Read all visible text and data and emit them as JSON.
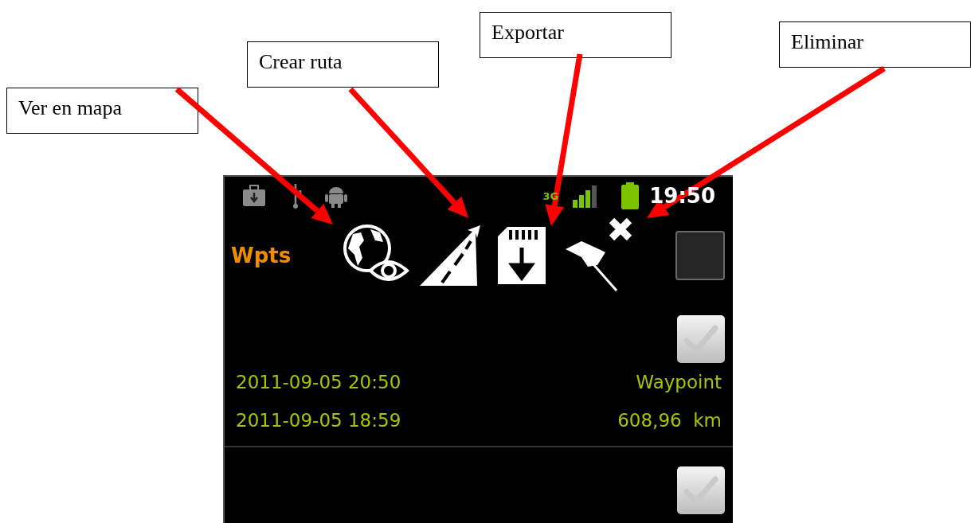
{
  "callouts": [
    {
      "label": "Ver en mapa"
    },
    {
      "label": "Crear ruta"
    },
    {
      "label": "Exportar"
    },
    {
      "label": "Eliminar"
    }
  ],
  "status_bar": {
    "network": "3G",
    "time": "19:50"
  },
  "toolbar": {
    "title": "Wpts",
    "select_all": {
      "checked": false
    }
  },
  "list": [
    {
      "checked": false,
      "lines": [
        {
          "left": "2011-09-05 20:50",
          "right": "Waypoint"
        },
        {
          "left": "2011-09-05 18:59",
          "right": "608,96  km"
        }
      ]
    },
    {
      "checked": false
    }
  ]
}
